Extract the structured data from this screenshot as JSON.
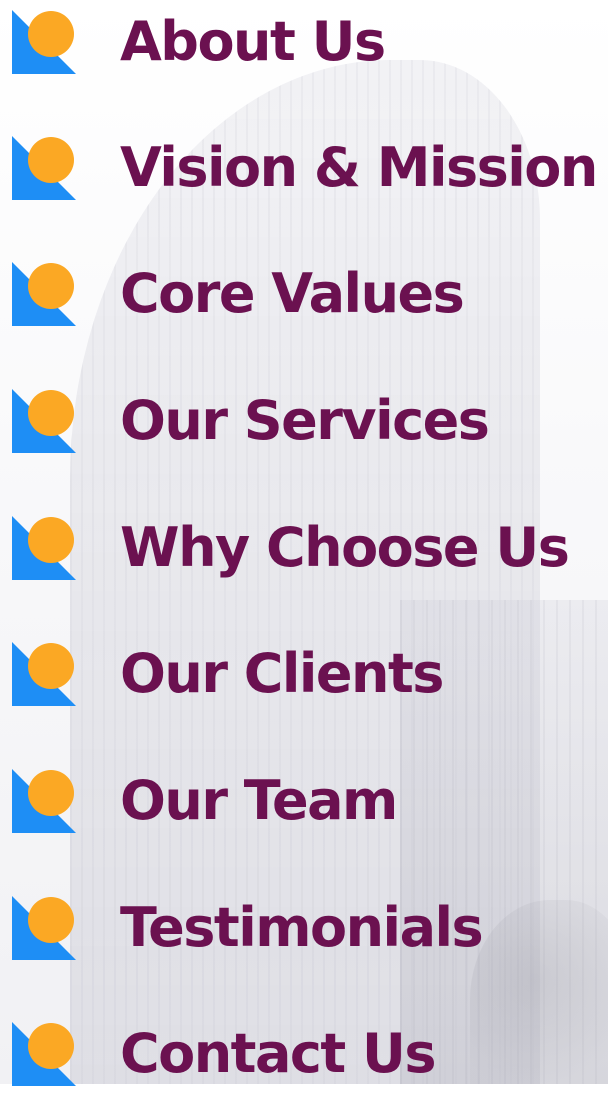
{
  "colors": {
    "text": "#6b1150",
    "icon_blue": "#1e8ef5",
    "icon_orange": "#fba824",
    "background": "#ffffff"
  },
  "menu": {
    "items": [
      {
        "label": "About Us",
        "icon": "bullet-icon"
      },
      {
        "label": "Vision & Mission",
        "icon": "bullet-icon"
      },
      {
        "label": "Core Values",
        "icon": "bullet-icon"
      },
      {
        "label": "Our Services",
        "icon": "bullet-icon"
      },
      {
        "label": "Why Choose Us",
        "icon": "bullet-icon"
      },
      {
        "label": "Our Clients",
        "icon": "bullet-icon"
      },
      {
        "label": "Our Team",
        "icon": "bullet-icon"
      },
      {
        "label": "Testimonials",
        "icon": "bullet-icon"
      },
      {
        "label": "Contact Us",
        "icon": "bullet-icon"
      }
    ]
  }
}
